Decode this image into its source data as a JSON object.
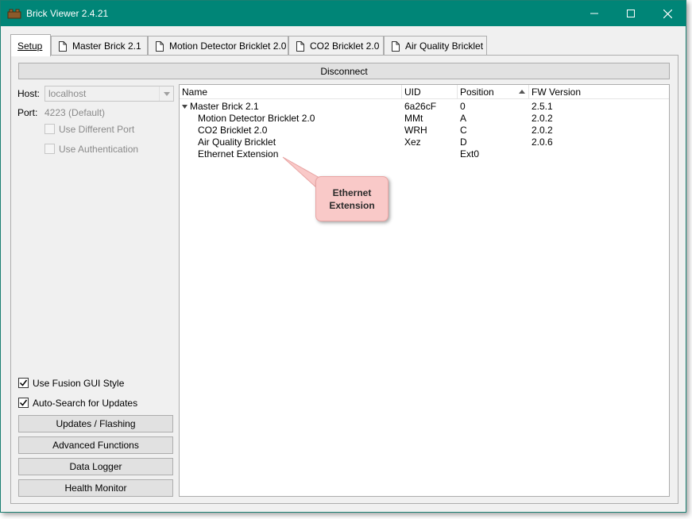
{
  "window": {
    "title": "Brick Viewer 2.4.21"
  },
  "tabs": [
    {
      "label": "Setup"
    },
    {
      "label": "Master Brick 2.1"
    },
    {
      "label": "Motion Detector Bricklet 2.0"
    },
    {
      "label": "CO2 Bricklet 2.0"
    },
    {
      "label": "Air Quality Bricklet"
    }
  ],
  "setup": {
    "disconnect_label": "Disconnect",
    "host_label": "Host:",
    "host_value": "localhost",
    "port_label": "Port:",
    "port_value": "4223 (Default)",
    "use_different_port": "Use Different Port",
    "use_authentication": "Use Authentication",
    "use_fusion_gui": "Use Fusion GUI Style",
    "auto_search": "Auto-Search for Updates",
    "updates_button": "Updates / Flashing",
    "advanced_button": "Advanced Functions",
    "data_logger_button": "Data Logger",
    "health_monitor_button": "Health Monitor"
  },
  "tree": {
    "columns": [
      "Name",
      "UID",
      "Position",
      "FW Version"
    ],
    "rows": [
      {
        "name": "Master Brick 2.1",
        "uid": "6a26cF",
        "position": "0",
        "fw": "2.5.1"
      },
      {
        "name": "Motion Detector Bricklet 2.0",
        "uid": "MMt",
        "position": "A",
        "fw": "2.0.2"
      },
      {
        "name": "CO2 Bricklet 2.0",
        "uid": "WRH",
        "position": "C",
        "fw": "2.0.2"
      },
      {
        "name": "Air Quality Bricklet",
        "uid": "Xez",
        "position": "D",
        "fw": "2.0.6"
      },
      {
        "name": "Ethernet Extension",
        "uid": "",
        "position": "Ext0",
        "fw": ""
      }
    ]
  },
  "callout": {
    "line1": "Ethernet",
    "line2": "Extension"
  },
  "colors": {
    "titlebar": "#008577",
    "callout": "#f9c9c8"
  }
}
